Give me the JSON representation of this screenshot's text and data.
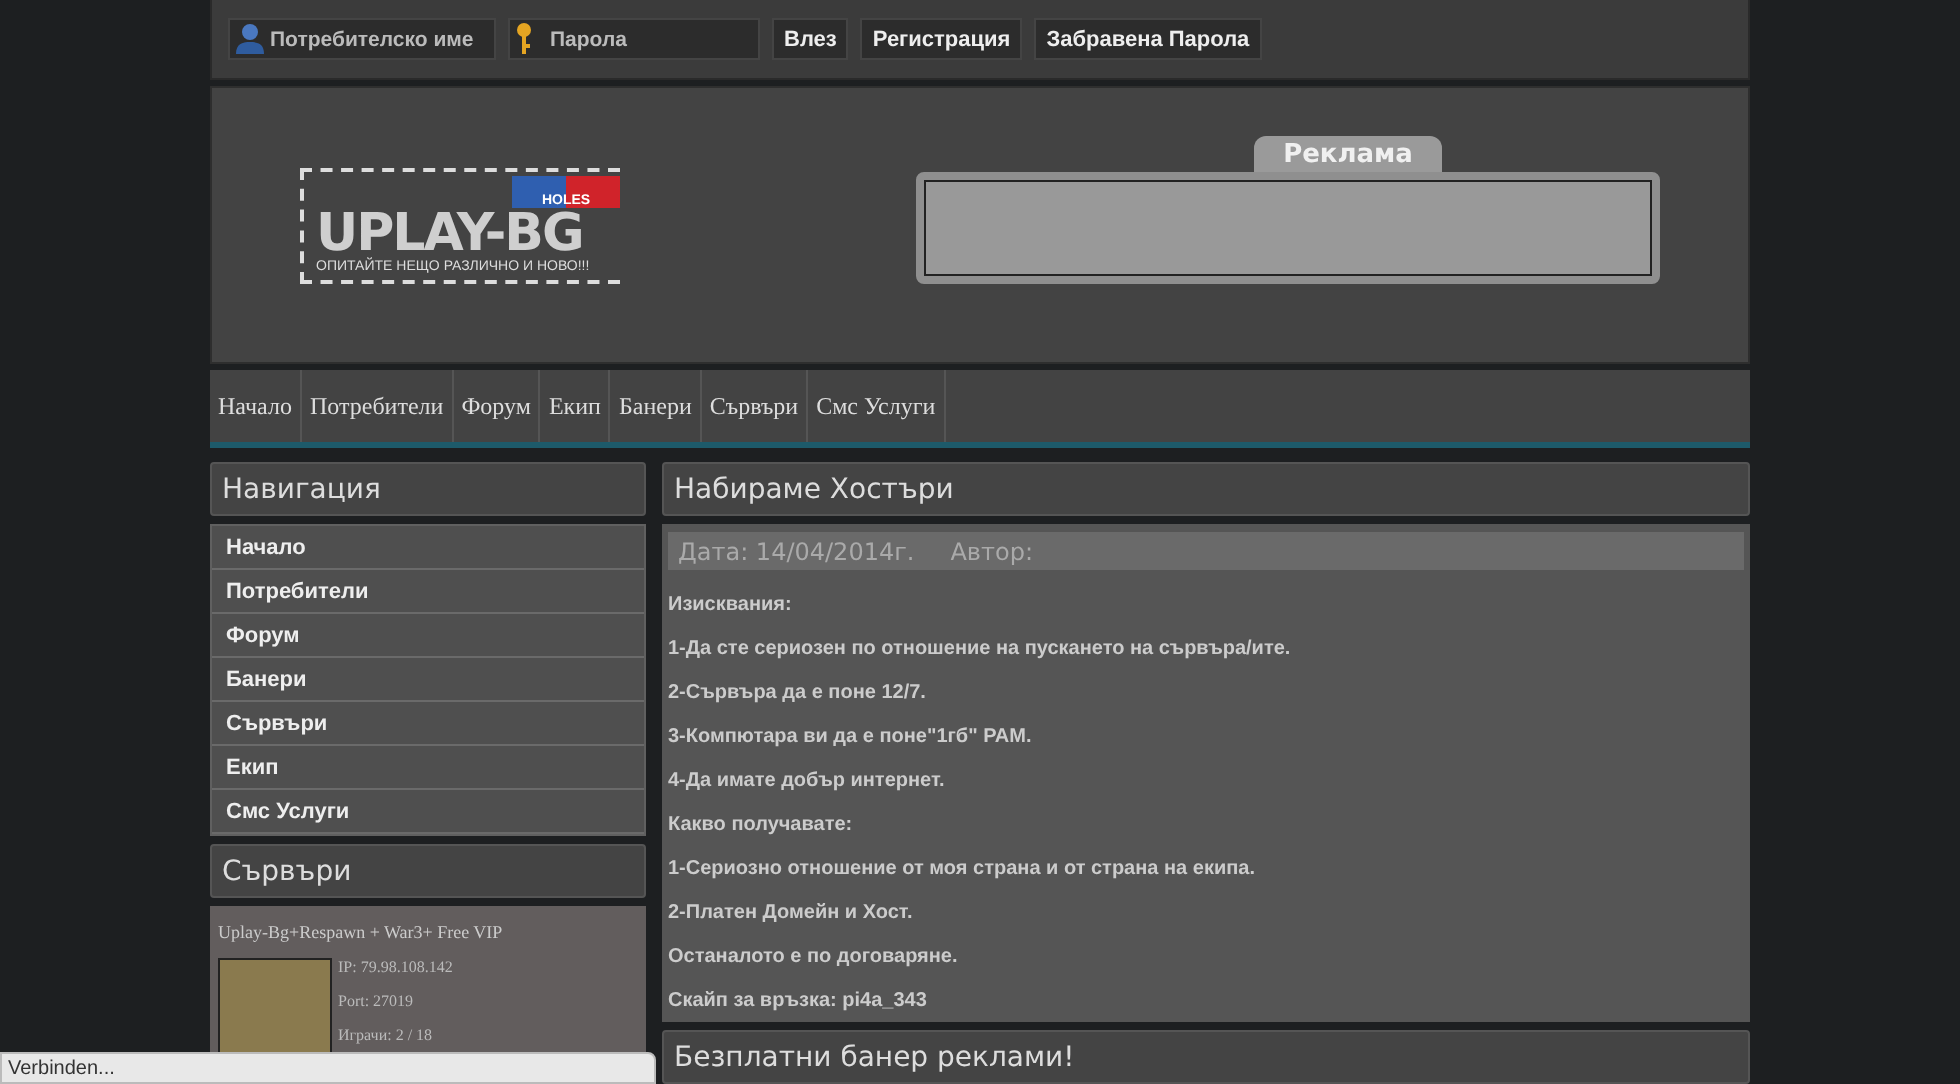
{
  "login_bar": {
    "username": {
      "placeholder": "Потребителско име"
    },
    "password": {
      "placeholder": "Парола"
    },
    "buttons": [
      "Влез",
      "Регистрация",
      "Забравена Парола"
    ]
  },
  "header": {
    "logo": {
      "title": "UPLAY-BG",
      "badge": "HOLES",
      "tagline": "ОПИТАЙТЕ НЕЩО РАЗЛИЧНО И НОВО!!!"
    },
    "ad": {
      "tab": "Реклама"
    }
  },
  "top_nav": [
    "Начало",
    "Потребители",
    "Форум",
    "Екип",
    "Банери",
    "Сървъри",
    "Смс Услуги"
  ],
  "sidebar": {
    "navigation": {
      "title": "Навигация",
      "items": [
        "Начало",
        "Потребители",
        "Форум",
        "Банери",
        "Сървъри",
        "Екип",
        "Смс Услуги"
      ]
    },
    "servers": {
      "title": "Сървъри",
      "server": {
        "name": "Uplay-Bg+Respawn + War3+ Free VIP",
        "details": [
          "IP: 79.98.108.142",
          "Port: 27019",
          "Играчи: 2 / 18"
        ]
      }
    }
  },
  "posts": [
    {
      "title": "Набираме Хостъри",
      "date": "Дата: 14/04/2014г.",
      "author_label": "Автор:",
      "body": [
        "Изисквания:",
        "1-Да сте сериозен по отношение на пускането на сървъра/ите.",
        "2-Сървъра да е поне 12/7.",
        "3-Компютара ви да е поне\"1гб\" РАМ.",
        "4-Да имате добър интернет.",
        "Какво получавате:",
        "1-Сериозно отношение от моя страна и от страна на екипа.",
        "2-Платен Домейн и Хост.",
        "Останалото е по договаряне.",
        "Скайп за връзка: pi4a_343"
      ]
    },
    {
      "title": "Безплатни банер реклами!"
    }
  ],
  "status_bar": "Verbinden..."
}
